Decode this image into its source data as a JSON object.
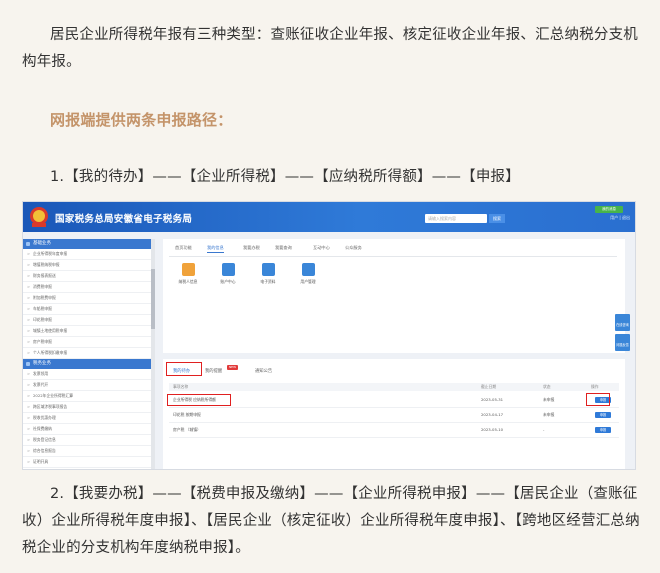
{
  "article": {
    "intro": "居民企业所得税年报有三种类型：查账征收企业年报、核定征收企业年报、汇总纳税分支机构年报。",
    "subheading": "网报端提供两条申报路径：",
    "path1": "1.【我的待办】——【企业所得税】——【应纳税所得额】——【申报】",
    "path2": "2.【我要办税】——【税费申报及缴纳】——【企业所得税申报】——【居民企业（查账征收）企业所得税年度申报】、【居民企业（核定征收）企业所得税年度申报】、【跨地区经营汇总纳税企业的分支机构年度纳税申报】。"
  },
  "screenshot": {
    "site_title": "国家税务总局安徽省电子税务局",
    "search_placeholder": "请输入搜索内容",
    "search_button": "搜索",
    "header_badge": "我的消息",
    "header_user": "用户 | 退出",
    "sidebar": {
      "section1": "基础业务",
      "items1": [
        "企业所得税年度申报",
        "增值税纳税申报",
        "财务报表报送",
        "消费税申报",
        "附加税费申报",
        "车船税申报",
        "印花税申报",
        "城镇土地使用税申报",
        "房产税申报",
        "个人所得税扣缴申报"
      ],
      "section2": "税务业务",
      "items2": [
        "发票领用",
        "发票代开",
        "2022年企业所得税汇算",
        "跨区域涉税事项报告",
        "税收优惠办理",
        "社保费缴纳",
        "税务登记信息",
        "综合信息报告",
        "证明开具"
      ]
    },
    "tabs": [
      "首页功能",
      "我的信息",
      "我要办税",
      "我要查询",
      "互动中心",
      "公众服务"
    ],
    "active_tab_index": 1,
    "services": [
      {
        "label": "纳税人信息",
        "color": "#f0a23a"
      },
      {
        "label": "账户中心",
        "color": "#3a86d8"
      },
      {
        "label": "电子资料",
        "color": "#3a86d8"
      },
      {
        "label": "用户管理",
        "color": "#3a86d8"
      }
    ],
    "panel_tabs": [
      "我的待办",
      "我的提醒",
      "通知公告"
    ],
    "new_badge": "NEW",
    "table_headers": [
      "事项名称",
      "截止日期",
      "状态",
      "操作"
    ],
    "rows": [
      {
        "name": "企业所得税 应纳税所得额",
        "date": "2023-05-31",
        "status": "未申报",
        "op": "申报"
      },
      {
        "name": "印花税 按期申报",
        "date": "2023-04-17",
        "status": "未申报",
        "op": "申报"
      },
      {
        "name": "房产税 （城镇）",
        "date": "2023-05-10",
        "status": "-",
        "op": "申报"
      }
    ],
    "float_buttons": [
      "在线咨询",
      "问题反馈"
    ]
  }
}
